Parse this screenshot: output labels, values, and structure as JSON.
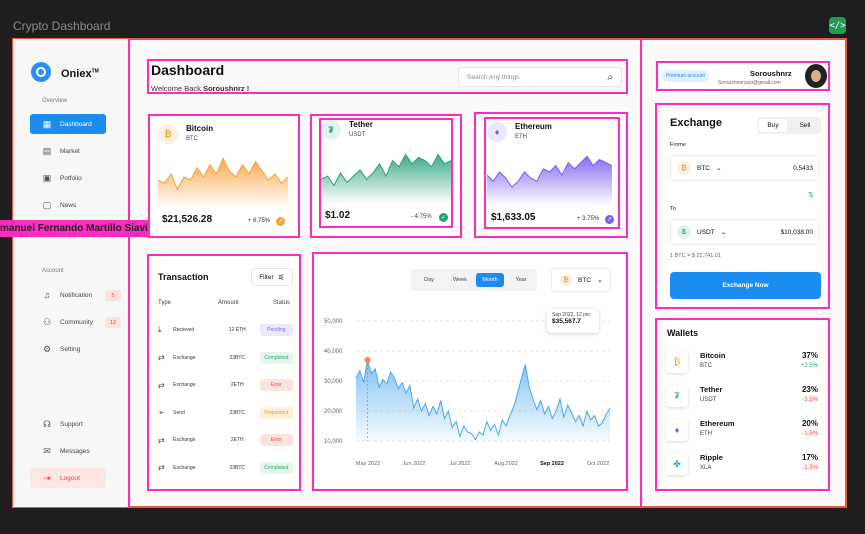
{
  "frame": {
    "title": "Crypto Dashboard",
    "code_icon": "</>"
  },
  "brand": {
    "name": "Oniex",
    "tm": "TM"
  },
  "sidebar": {
    "overview_label": "Overview",
    "account_label": "Account",
    "items": [
      {
        "label": "Dashboard",
        "icon": "grid-icon",
        "glyph": "▦",
        "active": true
      },
      {
        "label": "Market",
        "icon": "chart-icon",
        "glyph": "▤"
      },
      {
        "label": "Potfolio",
        "icon": "wallet-icon",
        "glyph": "▣"
      },
      {
        "label": "News",
        "icon": "news-icon",
        "glyph": "▢"
      },
      {
        "label": "",
        "icon": "hidden-icon",
        "glyph": "▢"
      }
    ],
    "account_items": [
      {
        "label": "Notification",
        "icon": "bell-icon",
        "glyph": "♫",
        "badge": "5"
      },
      {
        "label": "Community",
        "icon": "users-icon",
        "glyph": "⚇",
        "badge": "12"
      },
      {
        "label": "Setting",
        "icon": "gear-icon",
        "glyph": "⚙"
      }
    ],
    "bottom_items": [
      {
        "label": "Support",
        "icon": "headset-icon",
        "glyph": "☊"
      },
      {
        "label": "Messages",
        "icon": "message-icon",
        "glyph": "✉"
      },
      {
        "label": "Logout",
        "icon": "logout-icon",
        "glyph": "⇥"
      }
    ]
  },
  "name_tag": "manuel Fernando Martillo Siavichay",
  "header": {
    "title": "Dashboard",
    "welcome_prefix": "Welcome Back ",
    "welcome_name": "Soroushnrz !",
    "search_placeholder": "Search Any things"
  },
  "user": {
    "badge": "Premium account",
    "name": "Soroushnrz",
    "email": "Soroushnorouzi@gmail.com"
  },
  "coins": [
    {
      "name": "Bitcoin",
      "symbol": "BTC",
      "price": "$21,526.28",
      "change": "+ 6.75%",
      "glyph": "₿",
      "color": "#f7a13b",
      "bg": "#fdf0e1"
    },
    {
      "name": "Tether",
      "symbol": "USDT",
      "price": "$1.02",
      "change": "- 4.75%",
      "glyph": "₮",
      "color": "#26a17b",
      "bg": "#e2f4ee"
    },
    {
      "name": "Ethereum",
      "symbol": "ETH",
      "price": "$1,633.05",
      "change": "+ 3.75%",
      "glyph": "♦",
      "color": "#7b5cf0",
      "bg": "#ece7fd"
    }
  ],
  "transaction": {
    "title": "Transaction",
    "filter": "Filter",
    "headers": [
      "Type",
      "Amount",
      "Status"
    ],
    "rows": [
      {
        "glyph": "⤓",
        "type": "Recieved",
        "amount": "12 ETH",
        "status": "Pending",
        "fg": "#7a6cf0",
        "bg": "#ebe8fd"
      },
      {
        "glyph": "⇄",
        "type": "Exchange",
        "amount": "23BTC",
        "status": "Completed",
        "fg": "#29a86b",
        "bg": "#e3f6ec"
      },
      {
        "glyph": "⇄",
        "type": "Exchange",
        "amount": "2ETH",
        "status": "Error",
        "fg": "#e04848",
        "bg": "#fde3df"
      },
      {
        "glyph": "➢",
        "type": "Send",
        "amount": "23BTC",
        "status": "Requested",
        "fg": "#e0a030",
        "bg": "#fdf1dc"
      },
      {
        "glyph": "⇄",
        "type": "Exchange",
        "amount": "2ETH",
        "status": "Error",
        "fg": "#e04848",
        "bg": "#fde3df"
      },
      {
        "glyph": "⇄",
        "type": "Exchange",
        "amount": "23BTC",
        "status": "Completed",
        "fg": "#29a86b",
        "bg": "#e3f6ec"
      }
    ]
  },
  "chart_controls": {
    "periods": [
      "Day",
      "Week",
      "Month",
      "Year"
    ],
    "active": "Month",
    "coin": "BTC"
  },
  "chart_data": {
    "type": "area",
    "ylabel": "",
    "xlabel": "",
    "ylim": [
      10000,
      50000
    ],
    "yticks": [
      "50,000",
      "40,000",
      "30,000",
      "20,000",
      "10,000"
    ],
    "xticks": [
      "May 2022",
      "Jun 2022",
      "Jul 2022",
      "Aug 2022",
      "Sep 2022",
      "Oct 2022"
    ],
    "highlight_tick": "Sep 2022",
    "tooltip": {
      "date": "Sep 2022, 12 pm",
      "value": "$35,567.7"
    },
    "series": [
      {
        "values": [
          31000,
          33500,
          29500,
          37000,
          32500,
          34000,
          28000,
          30500,
          29000,
          33000,
          31000,
          27500,
          29500,
          26000,
          28500,
          21000,
          24000,
          20000,
          22500,
          18500,
          21500,
          19000,
          23500,
          17500,
          20000,
          14500,
          16500,
          11500,
          15000,
          13000,
          12500,
          10500,
          13000,
          12000,
          16500,
          13500,
          15500,
          12000,
          17000,
          15000,
          18500,
          21500,
          26000,
          31000,
          35500,
          28000,
          24000,
          20500,
          23500,
          19000,
          21500,
          17500,
          20000,
          24000,
          18000,
          22000,
          19500,
          16500,
          18500,
          15000,
          20000,
          17000,
          18500,
          15000,
          16000,
          19000,
          21000
        ]
      }
    ],
    "color": "#4aa8ec",
    "marker_color": "#f0873a"
  },
  "exchange": {
    "title": "Exchange",
    "buy": "Buy",
    "sell": "Sell",
    "from_label": "Frome",
    "to_label": "To",
    "from_coin": "BTC",
    "from_value": "0.5433",
    "to_coin": "USDT",
    "to_value": "$10,038.00",
    "rate": "1 BTC = $ 22,741.01",
    "button": "Exchange Now"
  },
  "wallets": {
    "title": "Wallets",
    "items": [
      {
        "name": "Bitcoin",
        "symbol": "BTC",
        "pct": "37%",
        "change": "+2.5%",
        "up": true,
        "glyph": "₿",
        "color": "#f7a13b"
      },
      {
        "name": "Tether",
        "symbol": "USDT",
        "pct": "23%",
        "change": "-3.5%",
        "up": false,
        "glyph": "₮",
        "color": "#26a17b"
      },
      {
        "name": "Ethereum",
        "symbol": "ETH",
        "pct": "20%",
        "change": "-1.5%",
        "up": false,
        "glyph": "♦",
        "color": "#7b5cf0"
      },
      {
        "name": "Ripple",
        "symbol": "XLA",
        "pct": "17%",
        "change": "-1.5%",
        "up": false,
        "glyph": "✤",
        "color": "#1d9be2"
      }
    ]
  },
  "colors": {
    "accent": "#1b8df0",
    "up": "#29a86b",
    "down": "#e04848",
    "highlight": "#ff2bbf"
  }
}
